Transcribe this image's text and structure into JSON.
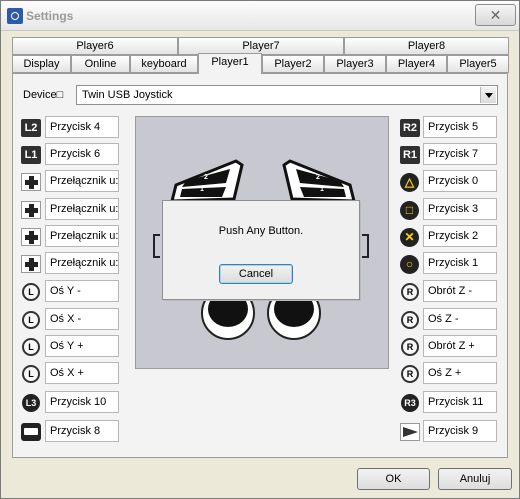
{
  "window": {
    "title": "Settings",
    "close_symbol": "✕"
  },
  "tabs": {
    "row1": [
      {
        "label": "Player6"
      },
      {
        "label": "Player7"
      },
      {
        "label": "Player8"
      }
    ],
    "row2": [
      {
        "label": "Display"
      },
      {
        "label": "Online"
      },
      {
        "label": "keyboard"
      },
      {
        "label": "Player1"
      },
      {
        "label": "Player2"
      },
      {
        "label": "Player3"
      },
      {
        "label": "Player4"
      },
      {
        "label": "Player5"
      }
    ],
    "active": "Player1"
  },
  "device": {
    "label": "Device",
    "label_box": "□",
    "value": "Twin USB Joystick"
  },
  "left_rows": [
    {
      "icon": "l2-button-icon",
      "icon_text": "L2",
      "value": "Przycisk 4"
    },
    {
      "icon": "l1-button-icon",
      "icon_text": "L1",
      "value": "Przycisk 6"
    },
    {
      "icon": "dpad-up-icon",
      "icon_text": "",
      "value": "Przełącznik u:"
    },
    {
      "icon": "dpad-left-icon",
      "icon_text": "",
      "value": "Przełącznik u:"
    },
    {
      "icon": "dpad-down-icon",
      "icon_text": "",
      "value": "Przełącznik u:"
    },
    {
      "icon": "dpad-right-icon",
      "icon_text": "",
      "value": "Przełącznik u:"
    },
    {
      "icon": "left-stick-up-icon",
      "icon_text": "L",
      "value": "Oś Y -"
    },
    {
      "icon": "left-stick-left-icon",
      "icon_text": "L",
      "value": "Oś X -"
    },
    {
      "icon": "left-stick-down-icon",
      "icon_text": "L",
      "value": "Oś Y +"
    },
    {
      "icon": "left-stick-right-icon",
      "icon_text": "L",
      "value": "Oś X +"
    },
    {
      "icon": "l3-button-icon",
      "icon_text": "L3",
      "value": "Przycisk 10"
    },
    {
      "icon": "select-button-icon",
      "icon_text": "",
      "value": "Przycisk 8"
    }
  ],
  "right_rows": [
    {
      "icon": "r2-button-icon",
      "icon_text": "R2",
      "value": "Przycisk 5"
    },
    {
      "icon": "r1-button-icon",
      "icon_text": "R1",
      "value": "Przycisk 7"
    },
    {
      "icon": "triangle-button-icon",
      "icon_text": "△",
      "value": "Przycisk 0"
    },
    {
      "icon": "square-button-icon",
      "icon_text": "□",
      "value": "Przycisk 3"
    },
    {
      "icon": "cross-button-icon",
      "icon_text": "✕",
      "value": "Przycisk 2"
    },
    {
      "icon": "circle-button-icon",
      "icon_text": "○",
      "value": "Przycisk 1"
    },
    {
      "icon": "right-stick-up-icon",
      "icon_text": "R",
      "value": "Obrót Z -"
    },
    {
      "icon": "right-stick-left-icon",
      "icon_text": "R",
      "value": "Oś Z -"
    },
    {
      "icon": "right-stick-down-icon",
      "icon_text": "R",
      "value": "Obrót Z +"
    },
    {
      "icon": "right-stick-right-icon",
      "icon_text": "R",
      "value": "Oś Z +"
    },
    {
      "icon": "r3-button-icon",
      "icon_text": "R3",
      "value": "Przycisk 11"
    },
    {
      "icon": "start-button-icon",
      "icon_text": "",
      "value": "Przycisk 9"
    }
  ],
  "preview": {
    "shoulder_left": [
      "2",
      "1"
    ],
    "shoulder_right": [
      "2",
      "1"
    ]
  },
  "popup": {
    "message": "Push Any Button.",
    "cancel_label": "Cancel"
  },
  "footer": {
    "ok_label": "OK",
    "cancel_label": "Anuluj"
  }
}
